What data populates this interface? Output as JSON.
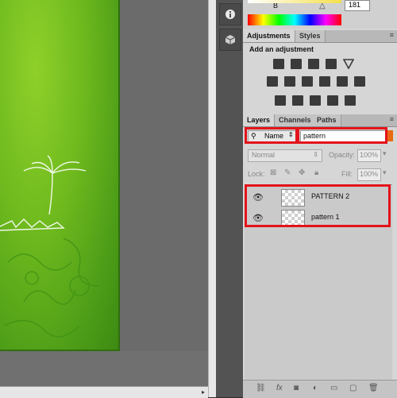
{
  "top": {
    "color_label": "B",
    "color_value": "181"
  },
  "adjustments": {
    "tabs": [
      "Adjustments",
      "Styles"
    ],
    "heading": "Add an adjustment",
    "icons": [
      "brightness-contrast-icon",
      "levels-icon",
      "curves-icon",
      "exposure-icon",
      "vibrance-icon",
      "hue-saturation-icon",
      "color-balance-icon",
      "black-white-icon",
      "photo-filter-icon",
      "channel-mixer-icon",
      "color-lookup-icon",
      "invert-icon",
      "posterize-icon",
      "threshold-icon",
      "gradient-map-icon",
      "selective-color-icon"
    ]
  },
  "layers": {
    "tabs": [
      "Layers",
      "Channels",
      "Paths"
    ],
    "filter_kind": "Name",
    "filter_text": "pattern",
    "blend_mode": "Normal",
    "opacity_label": "Opacity:",
    "opacity_value": "100%",
    "lock_label": "Lock:",
    "fill_label": "Fill:",
    "fill_value": "100%",
    "items": [
      {
        "name": "PATTERN 2"
      },
      {
        "name": "pattern 1"
      }
    ]
  },
  "footer_icons": [
    "link-icon",
    "fx-icon",
    "mask-icon",
    "adjustment-layer-icon",
    "group-icon",
    "new-layer-icon",
    "trash-icon"
  ],
  "colors": {
    "highlight": "#e3131b",
    "canvas_green": "#6fba1e"
  }
}
